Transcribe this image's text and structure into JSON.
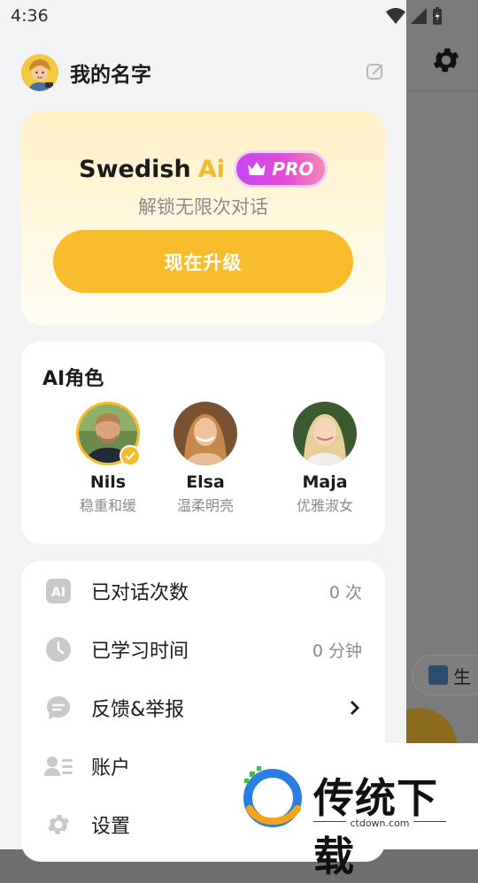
{
  "status_bar": {
    "time": "4:36"
  },
  "drawer": {
    "header": {
      "username": "我的名字"
    },
    "pro_card": {
      "brand": "Swedish",
      "ai": "Ai",
      "badge": "PRO",
      "subtitle": "解锁无限次对话",
      "button": "现在升级"
    },
    "roles": {
      "title": "AI角色",
      "items": [
        {
          "name": "Nils",
          "desc": "稳重和缓",
          "selected": true
        },
        {
          "name": "Elsa",
          "desc": "温柔明亮",
          "selected": false
        },
        {
          "name": "Maja",
          "desc": "优雅淑女",
          "selected": false
        }
      ]
    },
    "menu": {
      "items": [
        {
          "label": "已对话次数",
          "value": "0 次",
          "icon": "ai-icon"
        },
        {
          "label": "已学习时间",
          "value": "0 分钟",
          "icon": "clock-icon"
        },
        {
          "label": "反馈&举报",
          "value": "",
          "icon": "chat-bubble-icon"
        },
        {
          "label": "账户",
          "value": "",
          "icon": "account-icon"
        },
        {
          "label": "设置",
          "value": "",
          "icon": "gear-icon"
        }
      ]
    }
  },
  "background_app": {
    "chip_text": "生"
  },
  "watermark": {
    "title": "传统下载",
    "url": "ctdown.com"
  },
  "colors": {
    "accent": "#f8bd2c",
    "pro_gradient_start": "#c448f0",
    "pro_gradient_end": "#f58ab8"
  }
}
